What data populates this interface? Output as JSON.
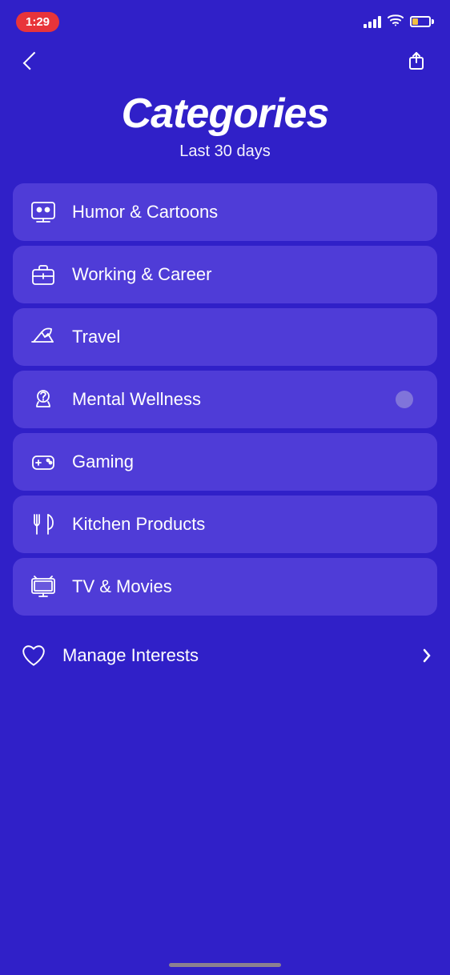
{
  "statusBar": {
    "time": "1:29",
    "wifi": true,
    "battery_level": 35
  },
  "nav": {
    "back_label": "Back",
    "share_label": "Share"
  },
  "header": {
    "title": "Categories",
    "subtitle": "Last 30 days"
  },
  "categories": [
    {
      "id": "humor-cartoons",
      "label": "Humor & Cartoons",
      "icon": "humor"
    },
    {
      "id": "working-career",
      "label": "Working & Career",
      "icon": "briefcase"
    },
    {
      "id": "travel",
      "label": "Travel",
      "icon": "travel"
    },
    {
      "id": "mental-wellness",
      "label": "Mental Wellness",
      "icon": "mental",
      "active": true
    },
    {
      "id": "gaming",
      "label": "Gaming",
      "icon": "gaming"
    },
    {
      "id": "kitchen-products",
      "label": "Kitchen Products",
      "icon": "kitchen"
    },
    {
      "id": "tv-movies",
      "label": "TV & Movies",
      "icon": "tv"
    }
  ],
  "manageInterests": {
    "label": "Manage Interests"
  }
}
